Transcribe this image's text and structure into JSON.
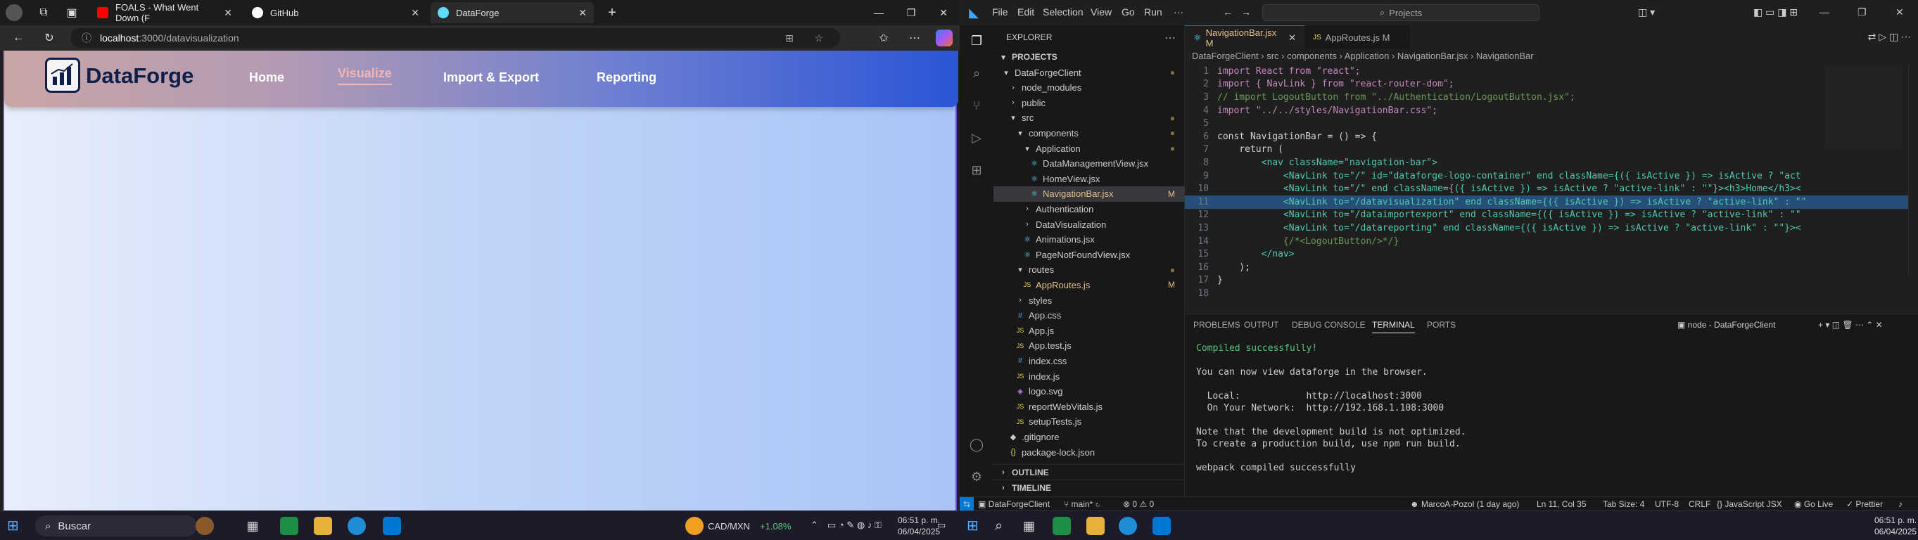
{
  "browser": {
    "tabs": [
      {
        "title": "FOALS - What Went Down (F",
        "icon": "youtube-icon",
        "color": "#ff0000"
      },
      {
        "title": "GitHub",
        "icon": "github-icon",
        "color": "#ffffff"
      },
      {
        "title": "DataForge",
        "icon": "react-icon",
        "color": "#61dafb"
      }
    ],
    "url_host": "localhost",
    "url_path": ":3000/datavisualization"
  },
  "app": {
    "brand": "DataForge",
    "nav": [
      "Home",
      "Visualize",
      "Import & Export",
      "Reporting"
    ]
  },
  "taskbar_left": {
    "search_placeholder": "Buscar",
    "ticker": "CAD/MXN",
    "ticker_change": "+1.08%",
    "time": "06:51 p. m.",
    "date": "06/04/2025"
  },
  "vscode": {
    "menu": [
      "File",
      "Edit",
      "Selection",
      "View",
      "Go",
      "Run",
      "···"
    ],
    "search": "Projects",
    "explorer_title": "EXPLORER",
    "projects_label": "PROJECTS",
    "tree": [
      {
        "label": "DataForgeClient",
        "icon": "▾",
        "indent": 1,
        "dot": true
      },
      {
        "label": "node_modules",
        "icon": "›",
        "indent": 2
      },
      {
        "label": "public",
        "icon": "›",
        "indent": 2
      },
      {
        "label": "src",
        "icon": "▾",
        "indent": 2,
        "dot": true
      },
      {
        "label": "components",
        "icon": "▾",
        "indent": 3,
        "dot": true
      },
      {
        "label": "Application",
        "icon": "▾",
        "indent": 4,
        "dot": true
      },
      {
        "label": "DataManagementView.jsx",
        "icon": "⚛",
        "indent": 5
      },
      {
        "label": "HomeView.jsx",
        "icon": "⚛",
        "indent": 5
      },
      {
        "label": "NavigationBar.jsx",
        "icon": "⚛",
        "indent": 5,
        "badge": "M",
        "selected": true
      },
      {
        "label": "Authentication",
        "icon": "›",
        "indent": 4
      },
      {
        "label": "DataVisualization",
        "icon": "›",
        "indent": 4
      },
      {
        "label": "Animations.jsx",
        "icon": "⚛",
        "indent": 4
      },
      {
        "label": "PageNotFoundView.jsx",
        "icon": "⚛",
        "indent": 4
      },
      {
        "label": "routes",
        "icon": "▾",
        "indent": 3,
        "dot": true
      },
      {
        "label": "AppRoutes.js",
        "icon": "JS",
        "indent": 4,
        "badge": "M"
      },
      {
        "label": "styles",
        "icon": "›",
        "indent": 3
      },
      {
        "label": "App.css",
        "icon": "#",
        "indent": 3
      },
      {
        "label": "App.js",
        "icon": "JS",
        "indent": 3
      },
      {
        "label": "App.test.js",
        "icon": "JS",
        "indent": 3
      },
      {
        "label": "index.css",
        "icon": "#",
        "indent": 3
      },
      {
        "label": "index.js",
        "icon": "JS",
        "indent": 3
      },
      {
        "label": "logo.svg",
        "icon": "◈",
        "indent": 3
      },
      {
        "label": "reportWebVitals.js",
        "icon": "JS",
        "indent": 3
      },
      {
        "label": "setupTests.js",
        "icon": "JS",
        "indent": 3
      },
      {
        "label": ".gitignore",
        "icon": "◆",
        "indent": 2
      },
      {
        "label": "package-lock.json",
        "icon": "{}",
        "indent": 2
      }
    ],
    "outline": "OUTLINE",
    "timeline": "TIMELINE",
    "tabs": [
      {
        "label": "NavigationBar.jsx M",
        "active": true
      },
      {
        "label": "AppRoutes.js M",
        "active": false
      }
    ],
    "breadcrumb": "DataForgeClient › src › components › Application › NavigationBar.jsx › NavigationBar",
    "code": [
      "import React from \"react\";",
      "import { NavLink } from \"react-router-dom\";",
      "// import LogoutButton from \"../Authentication/LogoutButton.jsx\";",
      "import \"../../styles/NavigationBar.css\";",
      "",
      "const NavigationBar = () => {",
      "    return (",
      "        <nav className=\"navigation-bar\">",
      "            <NavLink to=\"/\" id=\"dataforge-logo-container\" end className={({ isActive }) => isActive ? \"act",
      "            <NavLink to=\"/\" end className={({ isActive }) => isActive ? \"active-link\" : \"\"}><h3>Home</h3><",
      "            <NavLink to=\"/datavisualization\" end className={({ isActive }) => isActive ? \"active-link\" : \"\"",
      "            <NavLink to=\"/dataimportexport\" end className={({ isActive }) => isActive ? \"active-link\" : \"\"",
      "            <NavLink to=\"/datareporting\" end className={({ isActive }) => isActive ? \"active-link\" : \"\"}><",
      "            {/*<LogoutButton/>*/}",
      "        </nav>",
      "    );",
      "}",
      ""
    ],
    "current_line": 11,
    "panel_tabs": [
      "PROBLEMS",
      "OUTPUT",
      "DEBUG CONSOLE",
      "TERMINAL",
      "PORTS"
    ],
    "terminal_label": "node - DataForgeClient",
    "terminal": [
      "Compiled successfully!",
      "",
      "You can now view dataforge in the browser.",
      "",
      "  Local:            http://localhost:3000",
      "  On Your Network:  http://192.168.1.108:3000",
      "",
      "Note that the development build is not optimized.",
      "To create a production build, use npm run build.",
      "",
      "webpack compiled successfully"
    ],
    "status": {
      "project": "DataForgeClient",
      "branch": "main*",
      "errors": "0",
      "warnings": "0",
      "author": "MarcoA-Pozol (1 day ago)",
      "position": "Ln 11, Col 35",
      "tabsize": "Tab Size: 4",
      "encoding": "UTF-8",
      "eol": "CRLF",
      "lang": "JavaScript JSX",
      "golive": "Go Live",
      "prettier": "Prettier"
    },
    "time": "06:51 p. m.",
    "date": "06/04/2025"
  }
}
